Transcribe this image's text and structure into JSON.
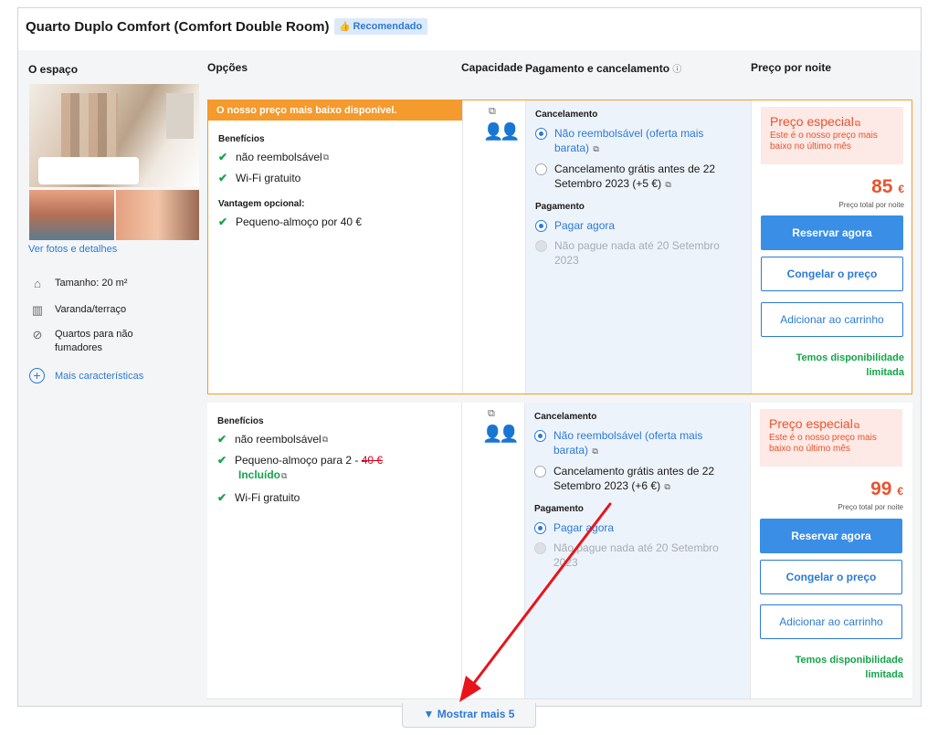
{
  "room": {
    "title": "Quarto Duplo Comfort (Comfort Double Room)",
    "badge": "Recomendado"
  },
  "space": {
    "title": "O espaço",
    "photos_link": "Ver fotos e detalhes",
    "features": [
      {
        "icon": "house-icon",
        "label": "Tamanho: 20 m²"
      },
      {
        "icon": "balcony-icon",
        "label": "Varanda/terraço"
      },
      {
        "icon": "no-smoking-icon",
        "label": "Quartos para não fumadores"
      }
    ],
    "more_features": "Mais características"
  },
  "columns": {
    "options": "Opções",
    "capacity": "Capacidade",
    "payment": "Pagamento e cancelamento",
    "price": "Preço por noite"
  },
  "rates": [
    {
      "banner": "O nosso preço mais baixo disponível.",
      "benefits_title": "Benefícios",
      "benefits": [
        "não reembolsável",
        "Wi-Fi gratuito"
      ],
      "optional_title": "Vantagem opcional:",
      "optional": [
        "Pequeno-almoço por 40 €"
      ],
      "cancel_title": "Cancelamento",
      "cancel_nonref": "Não reembolsável (oferta mais barata)",
      "cancel_free": "Cancelamento grátis antes de 22 Setembro 2023 (+5 €)",
      "pay_title": "Pagamento",
      "pay_now": "Pagar agora",
      "pay_later": "Não pague nada até 20 Setembro 2023",
      "special_title": "Preço especial",
      "special_desc": "Este é o nosso preço mais baixo no último mês",
      "amount": "85",
      "currency": "€",
      "total_label": "Preço total por noite",
      "btn_book": "Reservar agora",
      "btn_freeze": "Congelar o preço",
      "btn_cart": "Adicionar ao carrinho",
      "availability": "Temos disponibilidade limitada"
    },
    {
      "benefits_title": "Benefícios",
      "benefit1": "não reembolsável",
      "benefit2_prefix": "Pequeno-almoço para 2 - ",
      "benefit2_strike": "40 €",
      "benefit2_included": "Incluído",
      "benefit3": "Wi-Fi gratuito",
      "cancel_title": "Cancelamento",
      "cancel_nonref": "Não reembolsável (oferta mais barata)",
      "cancel_free": "Cancelamento grátis antes de 22 Setembro 2023 (+6 €)",
      "pay_title": "Pagamento",
      "pay_now": "Pagar agora",
      "pay_later": "Não pague nada até 20 Setembro 2023",
      "special_title": "Preço especial",
      "special_desc": "Este é o nosso preço mais baixo no último mês",
      "amount": "99",
      "currency": "€",
      "total_label": "Preço total por noite",
      "btn_book": "Reservar agora",
      "btn_freeze": "Congelar o preço",
      "btn_cart": "Adicionar ao carrinho",
      "availability": "Temos disponibilidade limitada"
    }
  ],
  "show_more": "Mostrar mais 5",
  "colors": {
    "accent": "#2c7ad6",
    "best_banner": "#f59a2c",
    "price": "#e8542e",
    "available": "#15a34a",
    "annotation_arrow": "#e8141a"
  }
}
